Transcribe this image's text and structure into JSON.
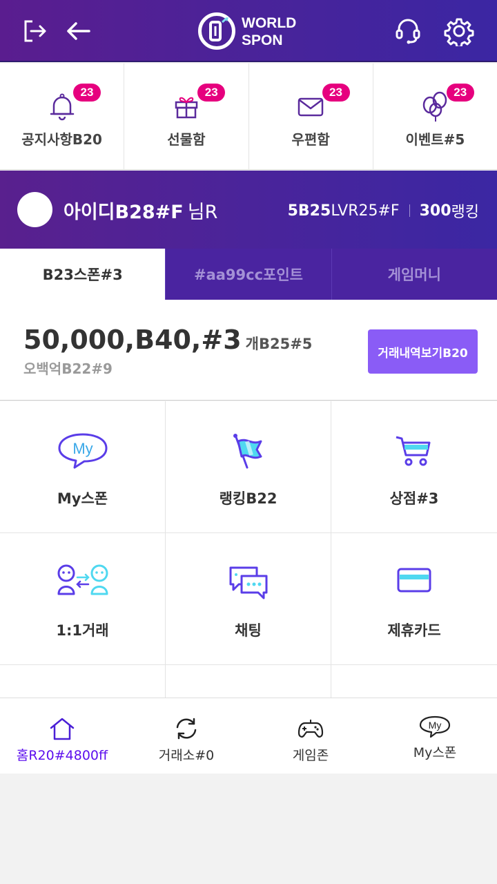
{
  "header": {
    "logo_text_line1": "WORLD",
    "logo_text_line2": "SPON",
    "icons": [
      "logout-icon",
      "back-arrow-icon",
      "headset-icon",
      "gear-icon"
    ]
  },
  "notices": [
    {
      "label": "공지사항B20",
      "badge": "23",
      "icon": "bell-icon"
    },
    {
      "label": "선물함",
      "badge": "23",
      "icon": "gift-icon"
    },
    {
      "label": "우편함",
      "badge": "23",
      "icon": "mail-icon"
    },
    {
      "label": "이벤트#5",
      "badge": "23",
      "icon": "balloons-icon"
    }
  ],
  "profile": {
    "name": "아이디B28#F",
    "suffix": "님R",
    "level_bold": "5B25",
    "level_rest": "LVR25#F",
    "rank_bold": "300",
    "rank_rest": "랭킹"
  },
  "tabs": [
    {
      "label": "B23스폰#3",
      "active": true
    },
    {
      "label": "#aa99cc포인트",
      "active": false
    },
    {
      "label": "게임머니",
      "active": false
    }
  ],
  "balance": {
    "amount": "50,000,B40,#3",
    "unit": "개B25#5",
    "sub": "오백억B22#9",
    "history_button": "거래내역보기B20"
  },
  "menu": [
    {
      "label": "My스폰",
      "icon": "my-speech-bubble-icon"
    },
    {
      "label": "랭킹B22",
      "icon": "flag-icon"
    },
    {
      "label": "상점#3",
      "icon": "cart-icon"
    },
    {
      "label": "1:1거래",
      "icon": "trade-people-icon"
    },
    {
      "label": "채팅",
      "icon": "chat-icon"
    },
    {
      "label": "제휴카드",
      "icon": "card-icon"
    }
  ],
  "bottom_nav": [
    {
      "label": "홈R20#4800ff",
      "icon": "home-icon",
      "active": true
    },
    {
      "label": "거래소#0",
      "icon": "refresh-icon",
      "active": false
    },
    {
      "label": "게임존",
      "icon": "gamepad-icon",
      "active": false
    },
    {
      "label": "My스폰",
      "icon": "my-bubble-icon",
      "active": false
    }
  ],
  "colors": {
    "primary_purple": "#4a249a",
    "accent_violet": "#8a5cf6",
    "badge_pink": "#e6007e",
    "nav_active": "#5d10ee",
    "icon_cyan": "#4fd8f0"
  }
}
